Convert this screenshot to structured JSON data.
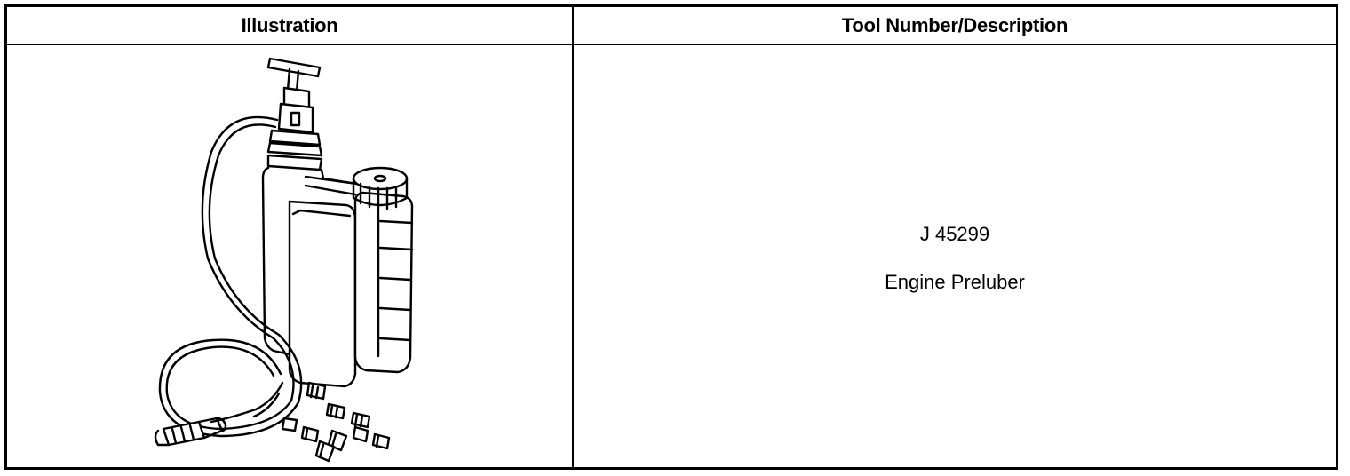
{
  "table": {
    "header": {
      "illustration": "Illustration",
      "tool_description": "Tool Number/Description"
    },
    "rows": [
      {
        "illustration_icon": "engine-preluber-illustration",
        "tool_number": "J 45299",
        "tool_name": "Engine Preluber"
      }
    ]
  }
}
